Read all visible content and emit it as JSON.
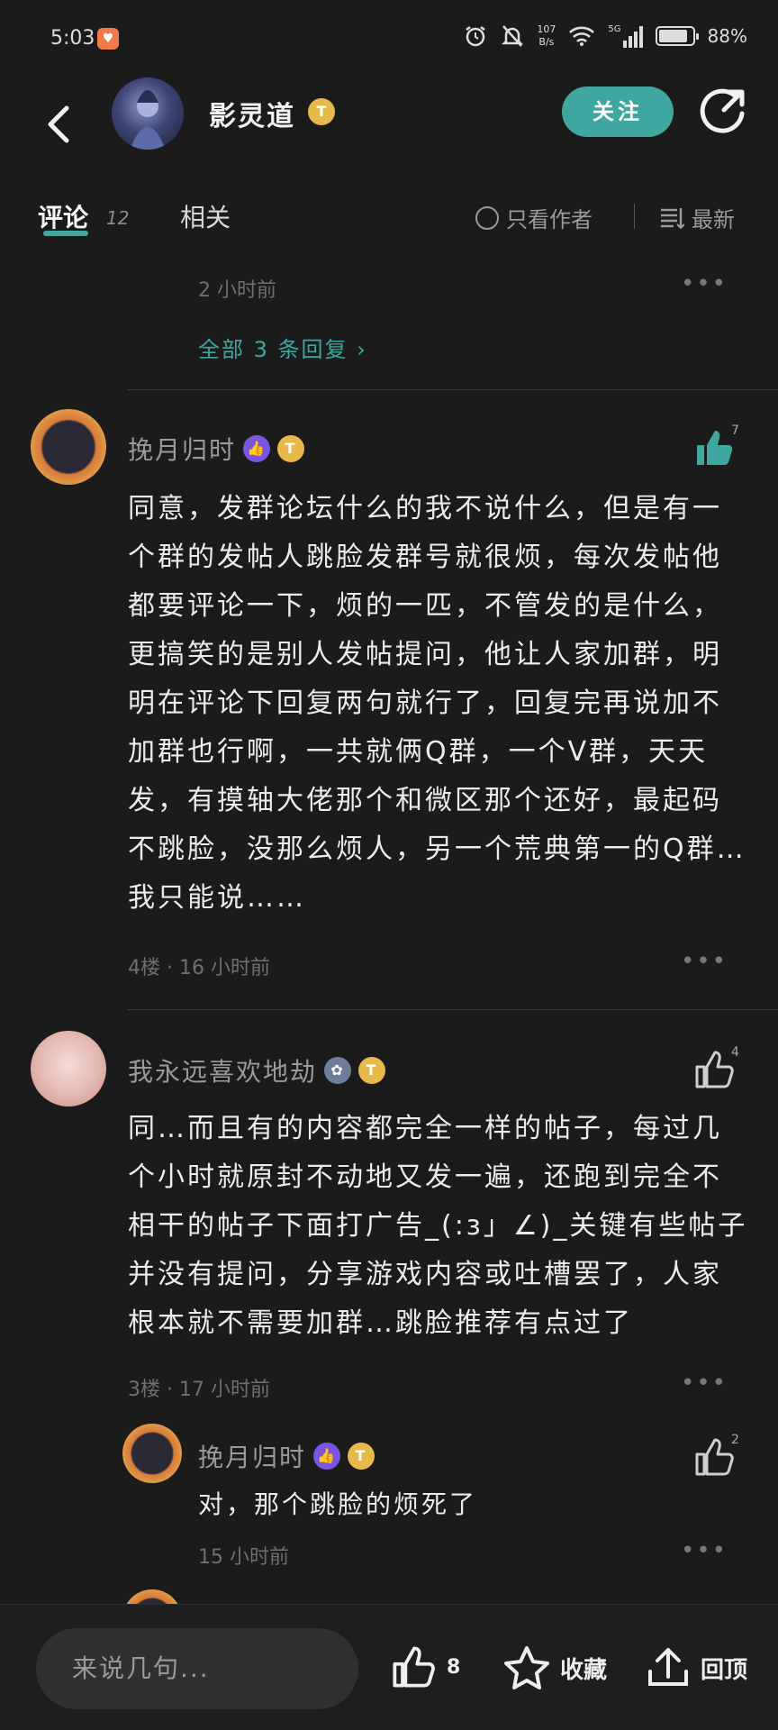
{
  "status": {
    "time": "5:03",
    "speed_top": "107",
    "speed_bottom": "B/s",
    "signal": "5G",
    "battery": "88%",
    "battery_level": 0.88
  },
  "header": {
    "author": "影灵道",
    "follow": "关注"
  },
  "tabs": {
    "comments": "评论",
    "comment_count": "12",
    "related": "相关",
    "only_author": "只看作者",
    "sort": "最新"
  },
  "prev_comment": {
    "time": "2 小时前",
    "all_replies": "全部 3 条回复 ›"
  },
  "comments": [
    {
      "name": "挽月归时",
      "likes": "7",
      "text": "同意，发群论坛什么的我不说什么，但是有一个群的发帖人跳脸发群号就很烦，每次发帖他都要评论一下，烦的一匹，不管发的是什么，更搞笑的是别人发帖提问，他让人家加群，明明在评论下回复两句就行了，回复完再说加不加群也行啊，一共就俩Q群，一个V群，天天发，有摸轴大佬那个和微区那个还好，最起码不跳脸，没那么烦人，另一个荒典第一的Q群…我只能说……",
      "meta": "4楼 · 16 小时前"
    },
    {
      "name": "我永远喜欢地劫",
      "likes": "4",
      "text": "同…而且有的内容都完全一样的帖子，每过几个小时就原封不动地又发一遍，还跑到完全不相干的帖子下面打广告_(:з」∠)_关键有些帖子并没有提问，分享游戏内容或吐槽罢了，人家根本就不需要加群…跳脸推荐有点过了",
      "meta": "3楼 · 17 小时前"
    }
  ],
  "reply": {
    "name": "挽月归时",
    "likes": "2",
    "text": "对，那个跳脸的烦死了",
    "time": "15 小时前"
  },
  "badges": {
    "gold": "T",
    "purple": "👍",
    "gray": "✿"
  },
  "bottom": {
    "placeholder": "来说几句...",
    "like_count": "8",
    "favorite": "收藏",
    "top": "回顶"
  },
  "colors": {
    "accent": "#3ea8a0",
    "background": "#1b1b1b"
  }
}
